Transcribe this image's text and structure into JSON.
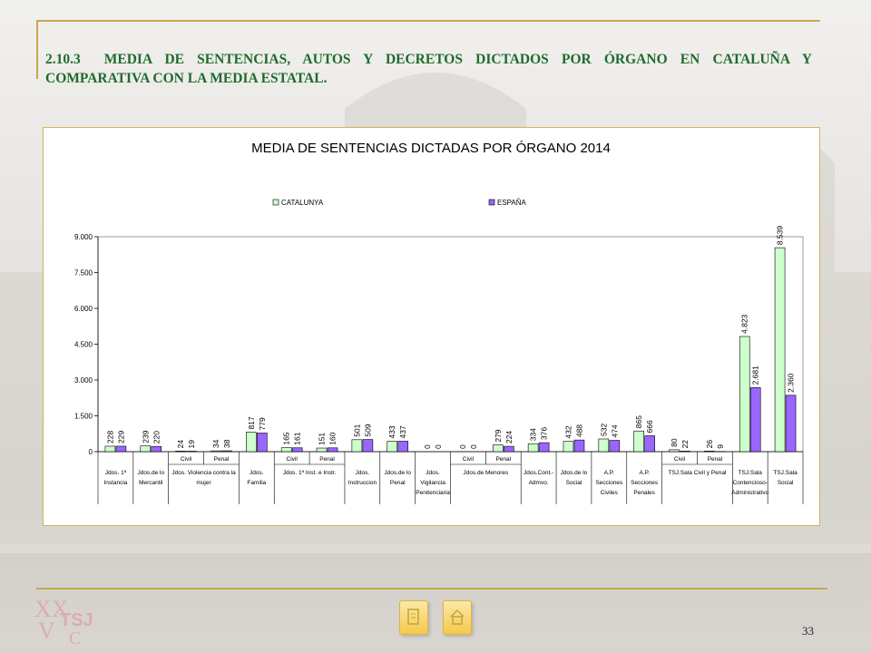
{
  "header": {
    "section_number": "2.10.3",
    "title": "MEDIA DE SENTENCIAS, AUTOS Y DECRETOS DICTADOS POR ÓRGANO EN CATALUÑA Y COMPARATIVA CON LA MEDIA ESTATAL."
  },
  "page_number": "33",
  "nav": {
    "prev_icon": "document-icon",
    "home_icon": "home-icon"
  },
  "logo": {
    "text": "TSJ C"
  },
  "chart_data": {
    "type": "bar",
    "title": "MEDIA DE SENTENCIAS DICTADAS POR ÓRGANO 2014",
    "legend_position": "top",
    "grid": false,
    "ylim": [
      0,
      9000
    ],
    "yticks": [
      "0",
      "1.500",
      "3.000",
      "4.500",
      "6.000",
      "7.500",
      "9.000"
    ],
    "ytick_values": [
      0,
      1500,
      3000,
      4500,
      6000,
      7500,
      9000
    ],
    "colors": {
      "CATALUNYA": "#ccffcc",
      "ESPAÑA": "#9966ff",
      "plot_bg": "#ffffff"
    },
    "categories": [
      {
        "line1": "",
        "line2": "Jdos. 1ª",
        "line3": "Instancia"
      },
      {
        "line1": "",
        "line2": "Jdos.de lo",
        "line3": "Mercantil"
      },
      {
        "line1": "Civil",
        "line2": "Jdos. Violencia contra la",
        "line3": "mujer"
      },
      {
        "line1": "Penal",
        "line2": "",
        "line3": ""
      },
      {
        "line1": "",
        "line2": "Jdos.",
        "line3": "Familia"
      },
      {
        "line1": "Civil",
        "line2": "Jdos. 1ª Inst. e Instr.",
        "line3": ""
      },
      {
        "line1": "Penal",
        "line2": "",
        "line3": ""
      },
      {
        "line1": "",
        "line2": "Jdos.",
        "line3": "Instruccion"
      },
      {
        "line1": "",
        "line2": "Jdos.de lo",
        "line3": "Penal"
      },
      {
        "line1": "",
        "line2": "Jdos.",
        "line3": "Vigilancia",
        "line4": "Penitenciaria"
      },
      {
        "line1": "Civil",
        "line2": "Jdos.de Menores",
        "line3": ""
      },
      {
        "line1": "Penal",
        "line2": "",
        "line3": ""
      },
      {
        "line1": "",
        "line2": "Jdos.Cont.-",
        "line3": "Admvo."
      },
      {
        "line1": "",
        "line2": "Jdos.de lo",
        "line3": "Social"
      },
      {
        "line1": "",
        "line2": "A.P.",
        "line3": "Secciones",
        "line4": "Civiles"
      },
      {
        "line1": "",
        "line2": "A.P.",
        "line3": "Secciones",
        "line4": "Penales"
      },
      {
        "line1": "Civil",
        "line2": "TSJ.Sala Civil y Penal",
        "line3": ""
      },
      {
        "line1": "Penal",
        "line2": "",
        "line3": ""
      },
      {
        "line1": "",
        "line2": "TSJ.Sala",
        "line3": "Contencioso-",
        "line4": "Administrativo"
      },
      {
        "line1": "",
        "line2": "TSJ.Sala",
        "line3": "Social"
      }
    ],
    "series": [
      {
        "name": "CATALUNYA",
        "values": [
          228,
          239,
          24,
          34,
          817,
          165,
          151,
          501,
          433,
          0,
          0,
          279,
          334,
          432,
          532,
          865,
          80,
          26,
          4823,
          8539
        ],
        "labels": [
          "228",
          "239",
          "24",
          "34",
          "817",
          "165",
          "151",
          "501",
          "433",
          "0",
          "0",
          "279",
          "334",
          "432",
          "532",
          "865",
          "80",
          "26",
          "4.823",
          "8.539"
        ]
      },
      {
        "name": "ESPAÑA",
        "values": [
          229,
          220,
          19,
          38,
          779,
          161,
          160,
          509,
          437,
          0,
          0,
          224,
          376,
          488,
          474,
          666,
          22,
          9,
          2681,
          2360
        ],
        "labels": [
          "229",
          "220",
          "19",
          "38",
          "779",
          "161",
          "160",
          "509",
          "437",
          "0",
          "0",
          "224",
          "376",
          "488",
          "474",
          "666",
          "22",
          "9",
          "2.681",
          "2.360"
        ]
      }
    ]
  }
}
